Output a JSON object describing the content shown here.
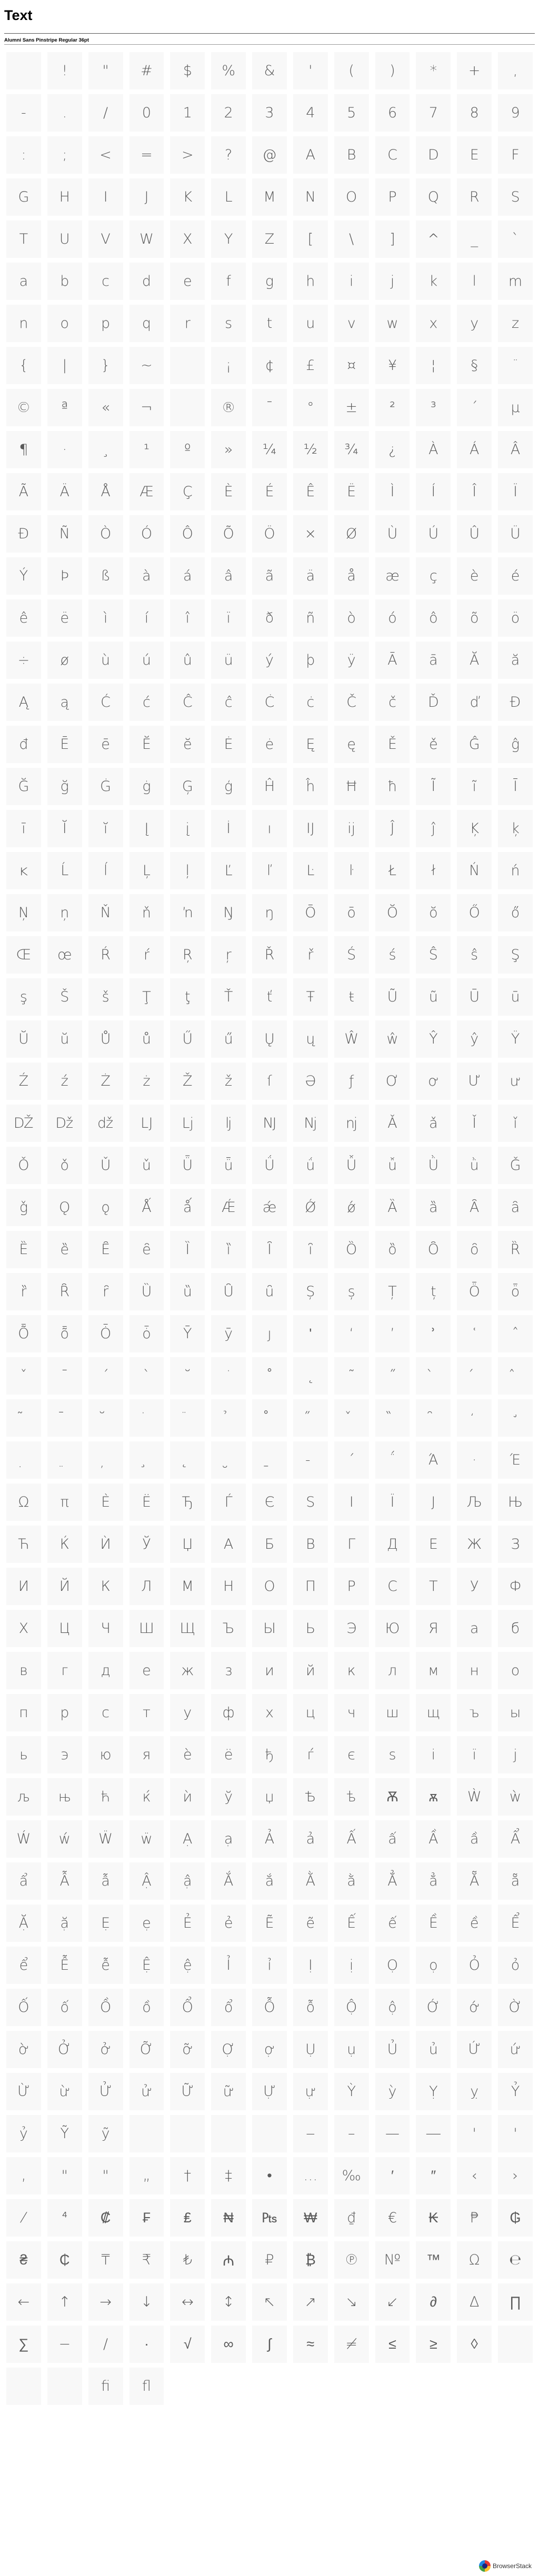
{
  "page": {
    "title": "Text",
    "subtitle": "Alumni Sans Pinstripe Regular 36pt"
  },
  "glyphs": [
    "",
    "!",
    "\"",
    "#",
    "$",
    "%",
    "&",
    "'",
    "(",
    ")",
    "*",
    "+",
    ",",
    "-",
    ".",
    "/",
    "0",
    "1",
    "2",
    "3",
    "4",
    "5",
    "6",
    "7",
    "8",
    "9",
    ":",
    ";",
    "<",
    "=",
    ">",
    "?",
    "@",
    "A",
    "B",
    "C",
    "D",
    "E",
    "F",
    "G",
    "H",
    "I",
    "J",
    "K",
    "L",
    "M",
    "N",
    "O",
    "P",
    "Q",
    "R",
    "S",
    "T",
    "U",
    "V",
    "W",
    "X",
    "Y",
    "Z",
    "[",
    "\\",
    "]",
    "^",
    "_",
    "`",
    "a",
    "b",
    "c",
    "d",
    "e",
    "f",
    "g",
    "h",
    "i",
    "j",
    "k",
    "l",
    "m",
    "n",
    "o",
    "p",
    "q",
    "r",
    "s",
    "t",
    "u",
    "v",
    "w",
    "x",
    "y",
    "z",
    "{",
    "|",
    "}",
    "~",
    "",
    "¡",
    "¢",
    "£",
    "¤",
    "¥",
    "¦",
    "§",
    "¨",
    "©",
    "ª",
    "«",
    "¬",
    "",
    "®",
    "¯",
    "°",
    "±",
    "²",
    "³",
    "´",
    "µ",
    "¶",
    "·",
    "¸",
    "¹",
    "º",
    "»",
    "¼",
    "½",
    "¾",
    "¿",
    "À",
    "Á",
    "Â",
    "Ã",
    "Ä",
    "Å",
    "Æ",
    "Ç",
    "È",
    "É",
    "Ê",
    "Ë",
    "Ì",
    "Í",
    "Î",
    "Ï",
    "Ð",
    "Ñ",
    "Ò",
    "Ó",
    "Ô",
    "Õ",
    "Ö",
    "×",
    "Ø",
    "Ù",
    "Ú",
    "Û",
    "Ü",
    "Ý",
    "Þ",
    "ß",
    "à",
    "á",
    "â",
    "ã",
    "ä",
    "å",
    "æ",
    "ç",
    "è",
    "é",
    "ê",
    "ë",
    "ì",
    "í",
    "î",
    "ï",
    "ð",
    "ñ",
    "ò",
    "ó",
    "ô",
    "õ",
    "ö",
    "÷",
    "ø",
    "ù",
    "ú",
    "û",
    "ü",
    "ý",
    "þ",
    "ÿ",
    "Ā",
    "ā",
    "Ă",
    "ă",
    "Ą",
    "ą",
    "Ć",
    "ć",
    "Ĉ",
    "ĉ",
    "Ċ",
    "ċ",
    "Č",
    "č",
    "Ď",
    "ď",
    "Đ",
    "đ",
    "Ē",
    "ē",
    "Ĕ",
    "ĕ",
    "Ė",
    "ė",
    "Ę",
    "ę",
    "Ě",
    "ě",
    "Ĝ",
    "ĝ",
    "Ğ",
    "ğ",
    "Ġ",
    "ġ",
    "Ģ",
    "ģ",
    "Ĥ",
    "ĥ",
    "Ħ",
    "ħ",
    "Ĩ",
    "ĩ",
    "Ī",
    "ī",
    "Ĭ",
    "ĭ",
    "Į",
    "į",
    "İ",
    "ı",
    "Ĳ",
    "ĳ",
    "Ĵ",
    "ĵ",
    "Ķ",
    "ķ",
    "ĸ",
    "Ĺ",
    "ĺ",
    "Ļ",
    "ļ",
    "Ľ",
    "ľ",
    "Ŀ",
    "ŀ",
    "Ł",
    "ł",
    "Ń",
    "ń",
    "Ņ",
    "ņ",
    "Ň",
    "ň",
    "ŉ",
    "Ŋ",
    "ŋ",
    "Ō",
    "ō",
    "Ŏ",
    "ŏ",
    "Ő",
    "ő",
    "Œ",
    "œ",
    "Ŕ",
    "ŕ",
    "Ŗ",
    "ŗ",
    "Ř",
    "ř",
    "Ś",
    "ś",
    "Ŝ",
    "ŝ",
    "Ş",
    "ş",
    "Š",
    "š",
    "Ţ",
    "ţ",
    "Ť",
    "ť",
    "Ŧ",
    "ŧ",
    "Ũ",
    "ũ",
    "Ū",
    "ū",
    "Ŭ",
    "ŭ",
    "Ů",
    "ů",
    "Ű",
    "ű",
    "Ų",
    "ų",
    "Ŵ",
    "ŵ",
    "Ŷ",
    "ŷ",
    "Ÿ",
    "Ź",
    "ź",
    "Ż",
    "ż",
    "Ž",
    "ž",
    "ſ",
    "Ə",
    "ƒ",
    "Ơ",
    "ơ",
    "Ư",
    "ư",
    "Ǆ",
    "ǅ",
    "ǆ",
    "Ǉ",
    "ǈ",
    "ǉ",
    "Ǌ",
    "ǋ",
    "ǌ",
    "Ǎ",
    "ǎ",
    "Ǐ",
    "ǐ",
    "Ǒ",
    "ǒ",
    "Ǔ",
    "ǔ",
    "Ǖ",
    "ǖ",
    "Ǘ",
    "ǘ",
    "Ǚ",
    "ǚ",
    "Ǜ",
    "ǜ",
    "Ǧ",
    "ǧ",
    "Ǫ",
    "ǫ",
    "Ǻ",
    "ǻ",
    "Ǽ",
    "ǽ",
    "Ǿ",
    "ǿ",
    "Ȁ",
    "ȁ",
    "Ȃ",
    "ȃ",
    "Ȅ",
    "ȅ",
    "Ȇ",
    "ȇ",
    "Ȉ",
    "ȉ",
    "Ȋ",
    "ȋ",
    "Ȍ",
    "ȍ",
    "Ȏ",
    "ȏ",
    "Ȑ",
    "ȑ",
    "Ȓ",
    "ȓ",
    "Ȕ",
    "ȕ",
    "Ȗ",
    "ȗ",
    "Ș",
    "ș",
    "Ț",
    "ț",
    "Ȫ",
    "ȫ",
    "Ȭ",
    "ȭ",
    "Ȱ",
    "ȱ",
    "Ȳ",
    "ȳ",
    "ȷ",
    "ʹ",
    "ʻ",
    "ʼ",
    "ʾ",
    "ʿ",
    "ˆ",
    "ˇ",
    "ˉ",
    "ˊ",
    "ˋ",
    "˘",
    "˙",
    "˚",
    "˛",
    "˜",
    "˝",
    "̀",
    "́",
    "̂",
    "̃",
    "̄",
    "̆",
    "̇",
    "̈",
    "̉",
    "̊",
    "̋",
    "̌",
    "̏",
    "̑",
    "̒",
    "̛",
    "̣",
    "̤",
    "̦",
    "̧",
    "̨",
    "̮",
    "̱",
    "̵",
    "΄",
    "΅",
    "Ά",
    "·",
    "Έ",
    "Ω",
    "π",
    "Ѐ",
    "Ё",
    "Ђ",
    "Ѓ",
    "Є",
    "Ѕ",
    "І",
    "Ї",
    "Ј",
    "Љ",
    "Њ",
    "Ћ",
    "Ќ",
    "Ѝ",
    "Ў",
    "Џ",
    "А",
    "Б",
    "В",
    "Г",
    "Д",
    "Е",
    "Ж",
    "З",
    "И",
    "Й",
    "К",
    "Л",
    "М",
    "Н",
    "О",
    "П",
    "Р",
    "С",
    "Т",
    "У",
    "Ф",
    "Х",
    "Ц",
    "Ч",
    "Ш",
    "Щ",
    "Ъ",
    "Ы",
    "Ь",
    "Э",
    "Ю",
    "Я",
    "а",
    "б",
    "в",
    "г",
    "д",
    "е",
    "ж",
    "з",
    "и",
    "й",
    "к",
    "л",
    "м",
    "н",
    "о",
    "п",
    "р",
    "с",
    "т",
    "у",
    "ф",
    "х",
    "ц",
    "ч",
    "ш",
    "щ",
    "ъ",
    "ы",
    "ь",
    "э",
    "ю",
    "я",
    "ѐ",
    "ё",
    "ђ",
    "ѓ",
    "є",
    "ѕ",
    "і",
    "ї",
    "ј",
    "љ",
    "њ",
    "ћ",
    "ќ",
    "ѝ",
    "ў",
    "џ",
    "Ѣ",
    "ѣ",
    "Ѫ",
    "ѫ",
    "Ẁ",
    "ẁ",
    "Ẃ",
    "ẃ",
    "Ẅ",
    "ẅ",
    "Ạ",
    "ạ",
    "Ả",
    "ả",
    "Ấ",
    "ấ",
    "Ầ",
    "ầ",
    "Ẩ",
    "ẩ",
    "Ẫ",
    "ẫ",
    "Ậ",
    "ậ",
    "Ắ",
    "ắ",
    "Ằ",
    "ằ",
    "Ẳ",
    "ẳ",
    "Ẵ",
    "ẵ",
    "Ặ",
    "ặ",
    "Ẹ",
    "ẹ",
    "Ẻ",
    "ẻ",
    "Ẽ",
    "ẽ",
    "Ế",
    "ế",
    "Ề",
    "ề",
    "Ể",
    "ể",
    "Ễ",
    "ễ",
    "Ệ",
    "ệ",
    "Ỉ",
    "ỉ",
    "Ị",
    "ị",
    "Ọ",
    "ọ",
    "Ỏ",
    "ỏ",
    "Ố",
    "ố",
    "Ồ",
    "ồ",
    "Ổ",
    "ổ",
    "Ỗ",
    "ỗ",
    "Ộ",
    "ộ",
    "Ớ",
    "ớ",
    "Ờ",
    "ờ",
    "Ở",
    "ở",
    "Ỡ",
    "ỡ",
    "Ợ",
    "ợ",
    "Ụ",
    "ụ",
    "Ủ",
    "ủ",
    "Ứ",
    "ứ",
    "Ừ",
    "ừ",
    "Ử",
    "ử",
    "Ữ",
    "ữ",
    "Ự",
    "ự",
    "Ỳ",
    "ỳ",
    "Ỵ",
    "ỵ",
    "Ỷ",
    "ỷ",
    "Ỹ",
    "ỹ",
    "",
    "",
    "",
    "",
    "‒",
    "–",
    "—",
    "―",
    "'",
    "'",
    "‚",
    "\"",
    "\"",
    "„",
    "†",
    "‡",
    "•",
    "…",
    "‰",
    "′",
    "″",
    "‹",
    "›",
    "⁄",
    "⁴",
    "₡",
    "₣",
    "₤",
    "₦",
    "₧",
    "₩",
    "₫",
    "€",
    "₭",
    "₱",
    "₲",
    "₴",
    "₵",
    "₸",
    "₹",
    "₺",
    "₼",
    "₽",
    "₿",
    "℗",
    "№",
    "™",
    "Ω",
    "℮",
    "←",
    "↑",
    "→",
    "↓",
    "↔",
    "↕",
    "↖",
    "↗",
    "↘",
    "↙",
    "∂",
    "∆",
    "∏",
    "∑",
    "−",
    "∕",
    "∙",
    "√",
    "∞",
    "∫",
    "≈",
    "≠",
    "≤",
    "≥",
    "◊",
    "",
    "",
    "",
    "ﬁ",
    "ﬂ"
  ],
  "footer": {
    "brand_label": "BrowserStack"
  }
}
